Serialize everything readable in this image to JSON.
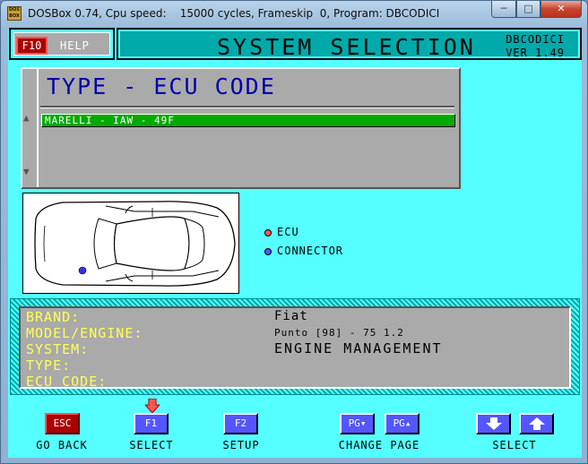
{
  "window": {
    "icon_text": "DOS BOX",
    "title": "DOSBox 0.74, Cpu speed:    15000 cycles, Frameskip  0, Program: DBCODICI",
    "min_glyph": "─",
    "max_glyph": "□",
    "close_glyph": "✕"
  },
  "topbar": {
    "f10_key": "F10",
    "help_label": "HELP"
  },
  "header": {
    "title": "SYSTEM SELECTION",
    "program": "DBCODICI",
    "version": "VER 1.49"
  },
  "list": {
    "title": "TYPE - ECU CODE",
    "items": [
      "MARELLI - IAW - 49F"
    ],
    "selected_index": 0,
    "scroll_up_glyph": "▲",
    "scroll_down_glyph": "▼"
  },
  "legend": {
    "ecu": "ECU",
    "connector": "CONNECTOR",
    "ecu_color": "#ff5555",
    "connector_color": "#5555ff"
  },
  "info": {
    "labels": {
      "brand": "BRAND:",
      "model_engine": "MODEL/ENGINE:",
      "system": "SYSTEM:",
      "type": "TYPE:",
      "ecu_code": "ECU CODE:"
    },
    "values": {
      "brand": "Fiat",
      "model_engine": "Punto [98] - 75 1.2",
      "system": "ENGINE MANAGEMENT",
      "type": "",
      "ecu_code": ""
    }
  },
  "keys": {
    "esc": {
      "key": "ESC",
      "label": "GO BACK"
    },
    "f1": {
      "key": "F1",
      "label": "SELECT"
    },
    "f2": {
      "key": "F2",
      "label": "SETUP"
    },
    "pg_down": {
      "key": "PG",
      "icon": "arrow-down-small-icon"
    },
    "pg_up": {
      "key": "PG",
      "icon": "arrow-up-small-icon"
    },
    "change_page_label": "CHANGE PAGE",
    "select_down": {
      "icon": "arrow-down-icon"
    },
    "select_up": {
      "icon": "arrow-up-icon"
    },
    "select_label": "SELECT"
  },
  "colors": {
    "background": "#55ffff",
    "header_bg": "#00aaaa",
    "panel_gray": "#aaaaaa",
    "title_blue": "#0000aa",
    "selected_green": "#00aa00",
    "label_yellow": "#ffff55",
    "key_red": "#aa0000",
    "key_blue": "#5555ff"
  }
}
